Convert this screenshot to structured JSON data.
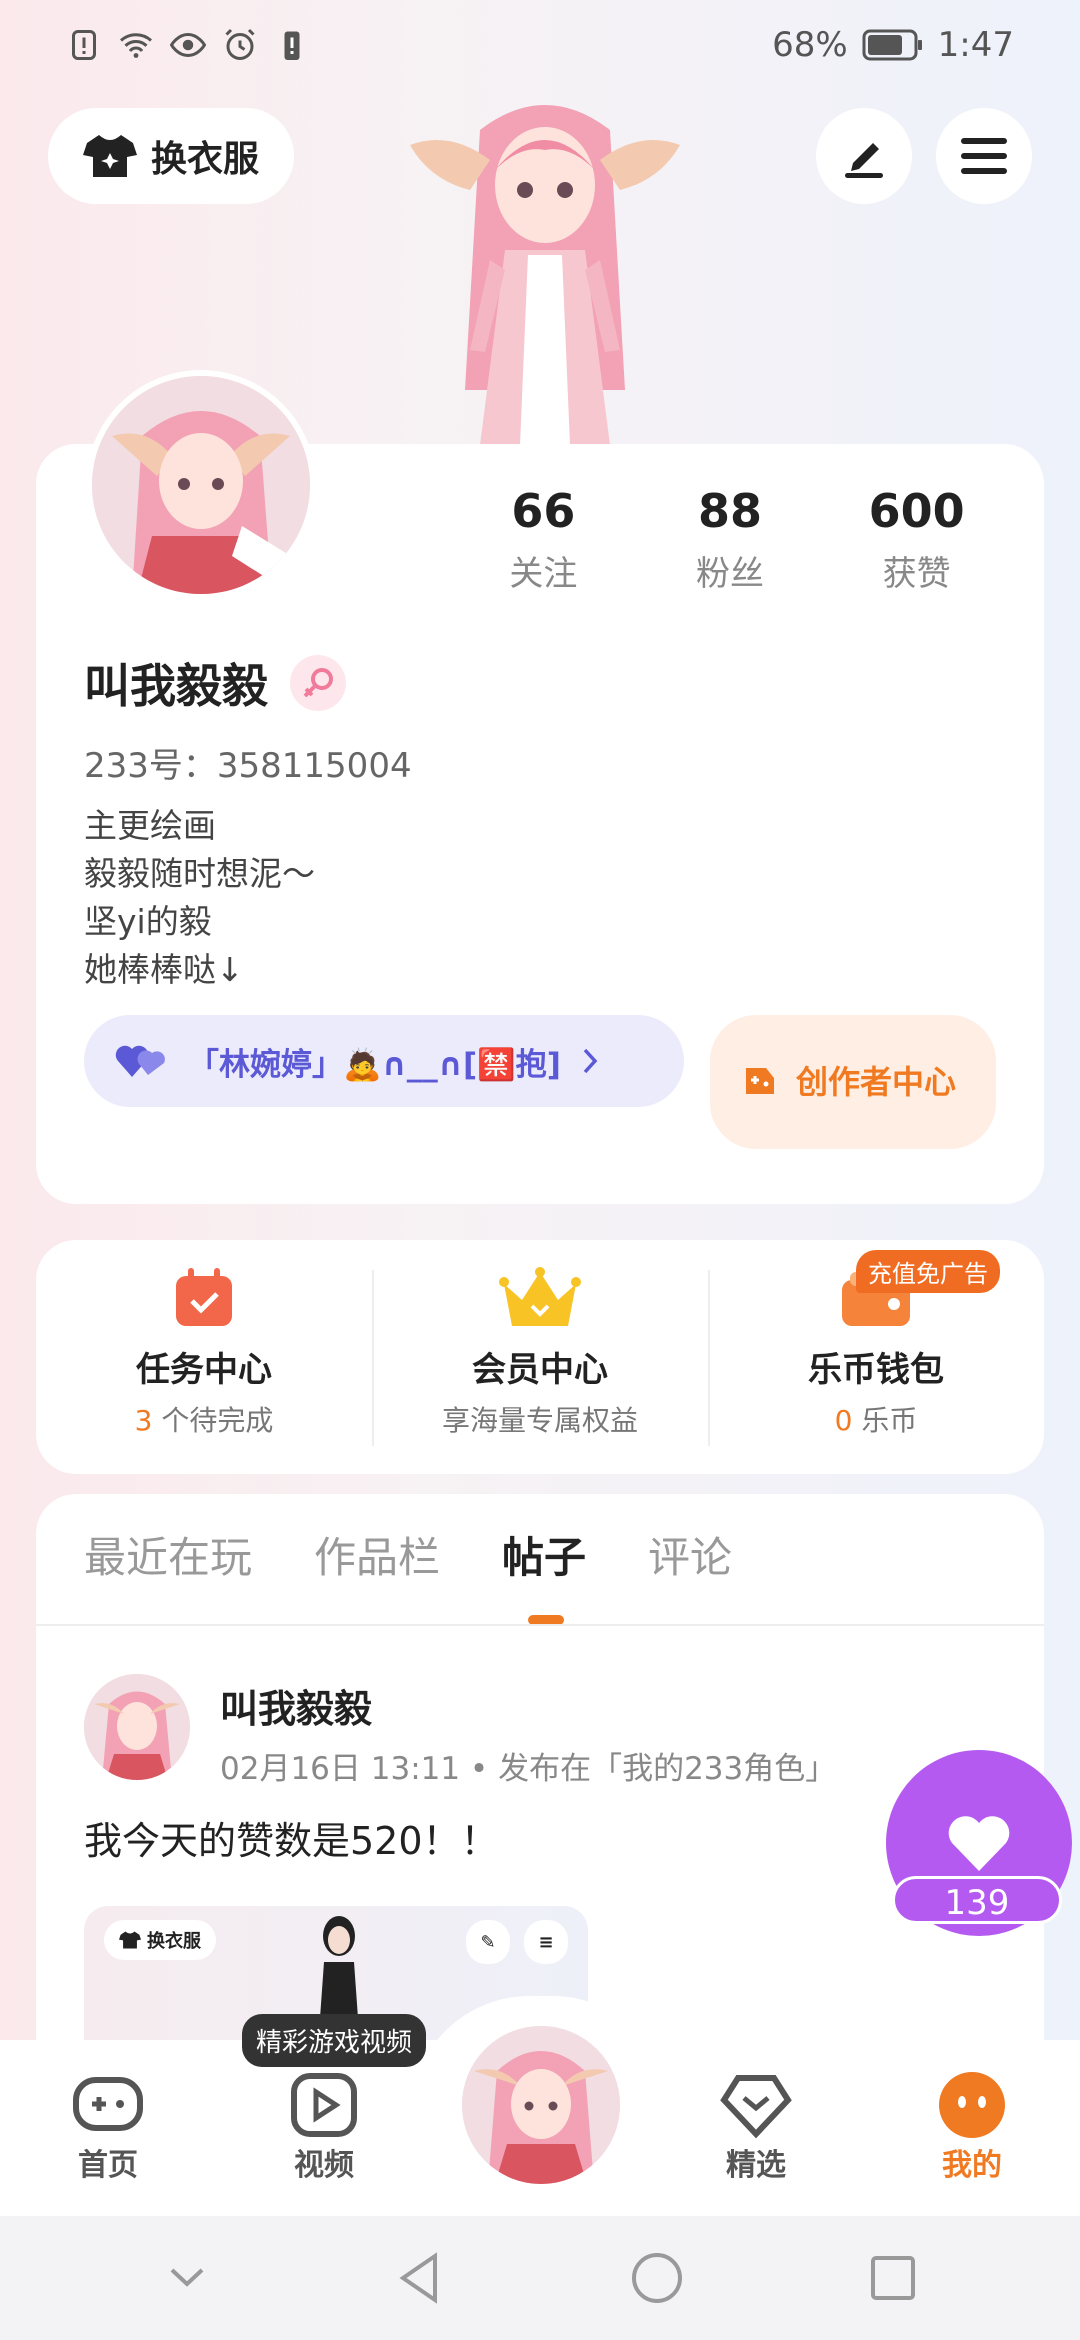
{
  "status_bar": {
    "battery": "68%",
    "time": "1:47"
  },
  "header": {
    "outfit_label": "换衣服"
  },
  "profile": {
    "stats": [
      {
        "value": "66",
        "label": "关注"
      },
      {
        "value": "88",
        "label": "粉丝"
      },
      {
        "value": "600",
        "label": "获赞"
      }
    ],
    "name": "叫我毅毅",
    "uid": "233号：358115004",
    "bio": [
      "主更绘画",
      "毅毅随时想泥～",
      "坚yi的毅",
      "她棒棒哒↓"
    ],
    "tag_pill": "「林婉婷」🙇∩__∩[🈲抱]",
    "creator_center": "创作者中心"
  },
  "center": {
    "items": [
      {
        "title": "任务中心",
        "count": "3",
        "sub": " 个待完成"
      },
      {
        "title": "会员中心",
        "count": "",
        "sub": "享海量专属权益"
      },
      {
        "title": "乐币钱包",
        "count": "0",
        "sub": " 乐币"
      }
    ],
    "promo": "充值免广告"
  },
  "feed": {
    "tabs": [
      "最近在玩",
      "作品栏",
      "帖子",
      "评论"
    ],
    "active_tab": "帖子",
    "post": {
      "author": "叫我毅毅",
      "meta": "02月16日 13:11 • 发布在「我的233角色」",
      "text": "我今天的赞数是520！！",
      "image_label": "换衣服"
    },
    "likes": "139"
  },
  "bottom_nav": {
    "tooltip": "精彩游戏视频",
    "items": [
      "首页",
      "视频",
      "精选",
      "我的"
    ],
    "active": "我的"
  },
  "colors": {
    "accent": "#f07a22",
    "like": "#b55af0",
    "pill": "#5b59d6"
  }
}
